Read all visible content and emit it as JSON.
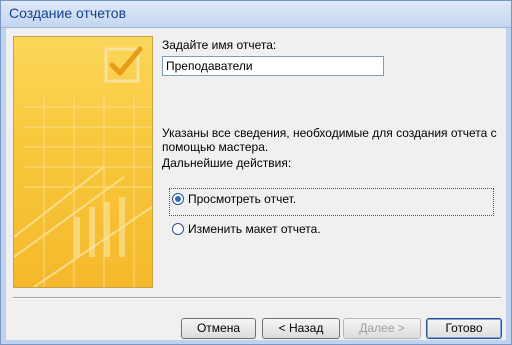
{
  "window": {
    "title": "Создание отчетов"
  },
  "form": {
    "name_label": "Задайте имя отчета:",
    "name_value": "Преподаватели",
    "info_text_line1": "Указаны все сведения, необходимые для создания отчета с",
    "info_text_line2": "помощью мастера.",
    "next_actions_label": "Дальнейшие действия:"
  },
  "options": [
    {
      "label": "Просмотреть отчет.",
      "selected": true
    },
    {
      "label": "Изменить макет отчета.",
      "selected": false
    }
  ],
  "buttons": {
    "cancel": "Отмена",
    "back": "< Назад",
    "next": "Далее >",
    "finish": "Готово"
  }
}
